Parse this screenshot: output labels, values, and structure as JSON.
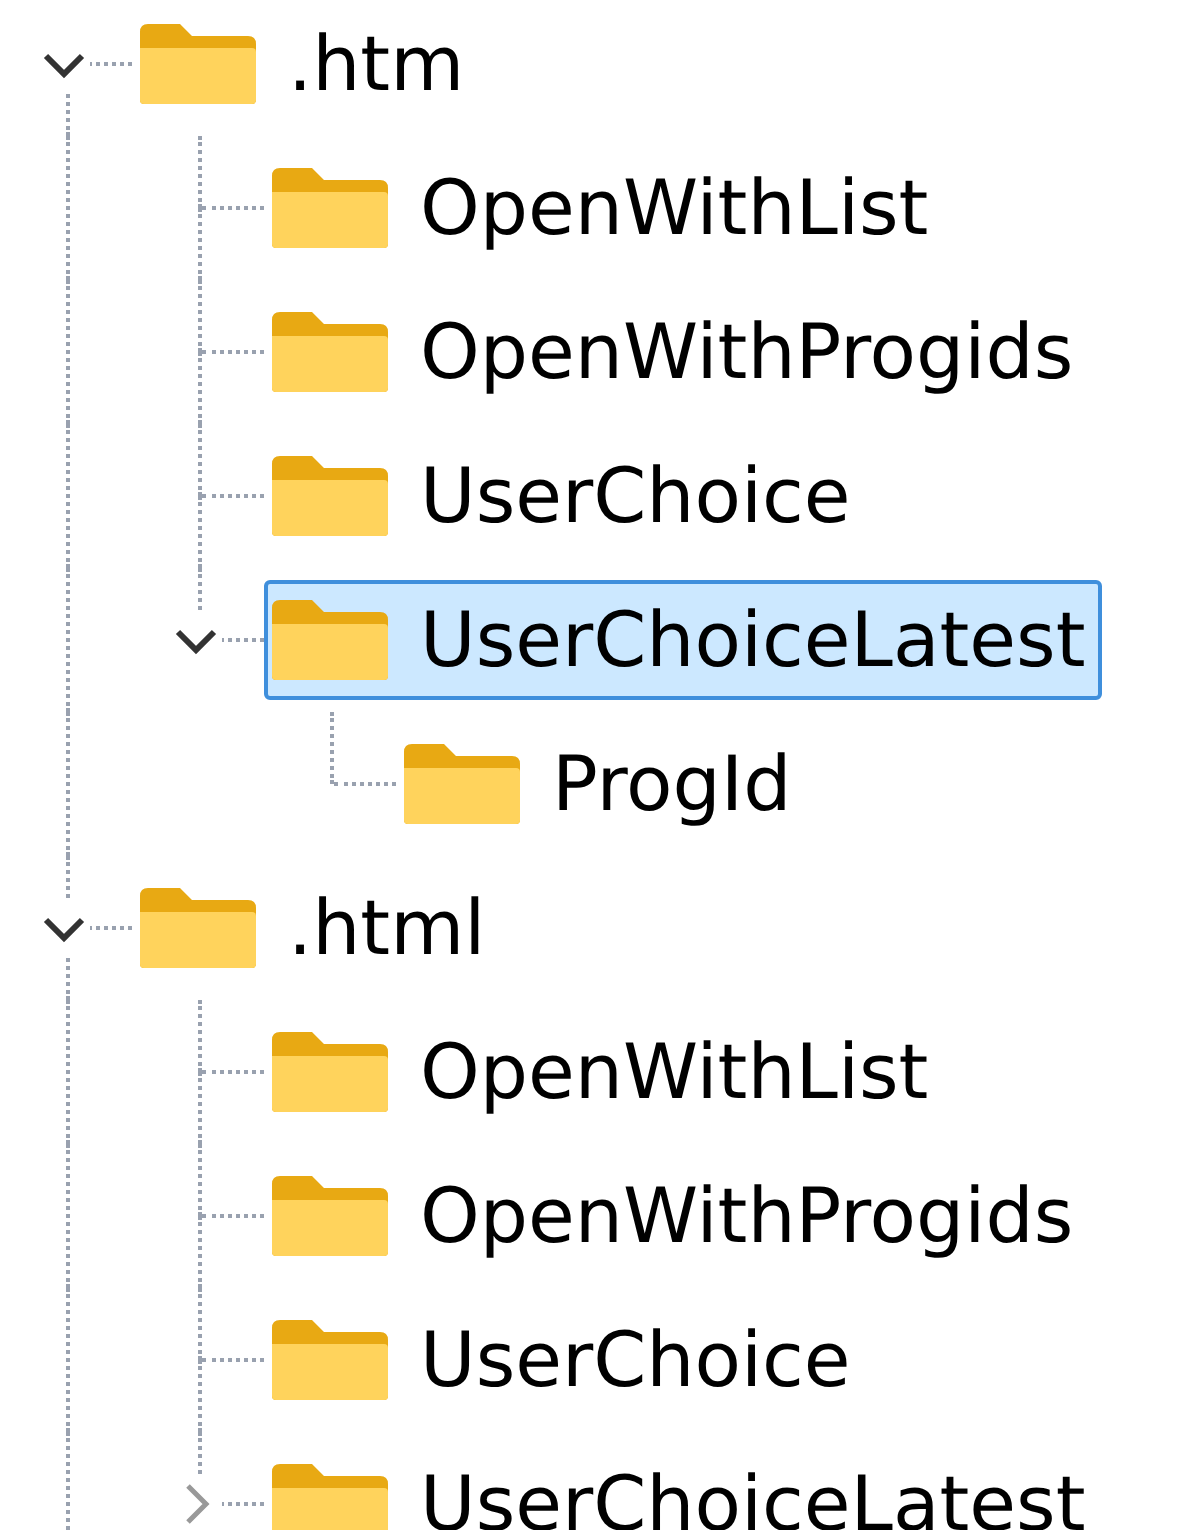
{
  "tree": [
    {
      "label": ".htm",
      "expanded": true,
      "selected": false,
      "children": [
        {
          "label": "OpenWithList",
          "selected": false
        },
        {
          "label": "OpenWithProgids",
          "selected": false
        },
        {
          "label": "UserChoice",
          "selected": false
        },
        {
          "label": "UserChoiceLatest",
          "expanded": true,
          "selected": true,
          "children": [
            {
              "label": "ProgId",
              "selected": false
            }
          ]
        }
      ]
    },
    {
      "label": ".html",
      "expanded": true,
      "selected": false,
      "children": [
        {
          "label": "OpenWithList",
          "selected": false
        },
        {
          "label": "OpenWithProgids",
          "selected": false
        },
        {
          "label": "UserChoice",
          "selected": false
        },
        {
          "label": "UserChoiceLatest",
          "expanded": false,
          "selected": false
        }
      ]
    }
  ]
}
